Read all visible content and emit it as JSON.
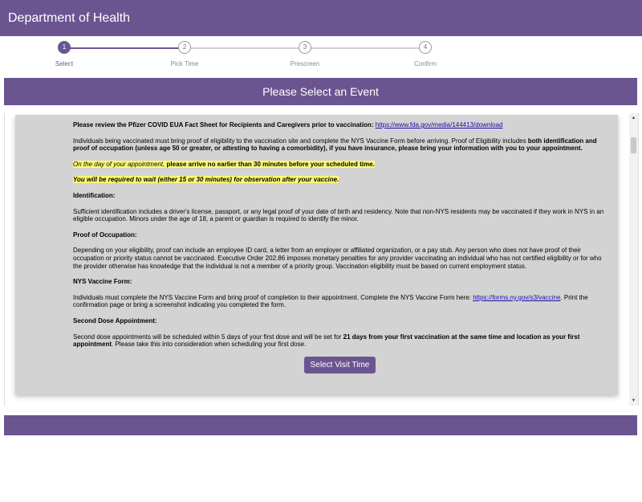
{
  "header": {
    "title": "Department of Health"
  },
  "steps": [
    {
      "number": "1",
      "label": "Select",
      "active": true
    },
    {
      "number": "2",
      "label": "Pick Time",
      "active": false
    },
    {
      "number": "3",
      "label": "Prescreen",
      "active": false
    },
    {
      "number": "4",
      "label": "Confirm",
      "active": false
    }
  ],
  "event_bar": {
    "title": "Please Select an Event"
  },
  "content": {
    "p1_bold": "Please review the Pfizer COVID EUA Fact Sheet for Recipients and Caregivers prior to vaccination:",
    "p1_link": "https://www.fda.gov/media/144413/download",
    "p2_a": "Individuals being vaccinated must bring proof of eligibility to the vaccination site and complete the NYS Vaccine Form before arriving. Proof of Eligibility includes",
    "p2_b": "both identification and proof of occupation (unless age 50 or greater, or attesting to having a comorbidity), if you have insurance, please bring your information with you to your appointment.",
    "hl1_italic": "On the day of your appointment,",
    "hl1_bold": "please arrive no earlier than 30 minutes before your scheduled time.",
    "hl2": "You will be required to wait (either 15 or 30 minutes) for observation after your vaccine.",
    "h_identification": "Identification:",
    "p_identification": "Sufficient identification includes a driver's license, passport, or any legal proof of your date of birth and residency. Note that non-NYS residents may be vaccinated if they work in NYS in an eligible occupation. Minors under the age of 18, a parent or guardian is required to identify the minor.",
    "h_occupation": "Proof of Occupation:",
    "p_occupation": "Depending on your eligibility, proof can include an employee ID card, a letter from an employer or affiliated organization, or a pay stub. Any person who does not have proof of their occupation or priority status cannot be vaccinated. Executive Order 202.86 imposes monetary penalties for any provider vaccinating an individual who has not certified eligibility or for who the provider otherwise has knowledge that the individual is not a member of a priority group. Vaccination eligibility must be based on current employment status.",
    "h_form": "NYS Vaccine Form:",
    "p_form_a": "Individuals must complete the NYS Vaccine Form and bring proof of completion to their appointment.  Complete the NYS Vaccine Form here:",
    "p_form_link": "https://forms.ny.gov/s3/vaccine",
    "p_form_b": ". Print the confirmation page or bring a screenshot indicating you completed the form.",
    "h_second": "Second Dose Appointment:",
    "p_second_a": "Second dose appointments will be scheduled within 5 days of your first dose and will be set for",
    "p_second_b": "21 days from your first vaccination at the same time and location as your first appointment",
    "p_second_c": ". Please take this into consideration when scheduling your first dose.",
    "button_label": "Select Visit Time"
  },
  "colors": {
    "brand": "#6b5591",
    "highlight": "#fdfa73",
    "panel_bg": "#d3d3d3"
  },
  "scrollbar": {
    "up_icon": "▲",
    "down_icon": "▼"
  }
}
